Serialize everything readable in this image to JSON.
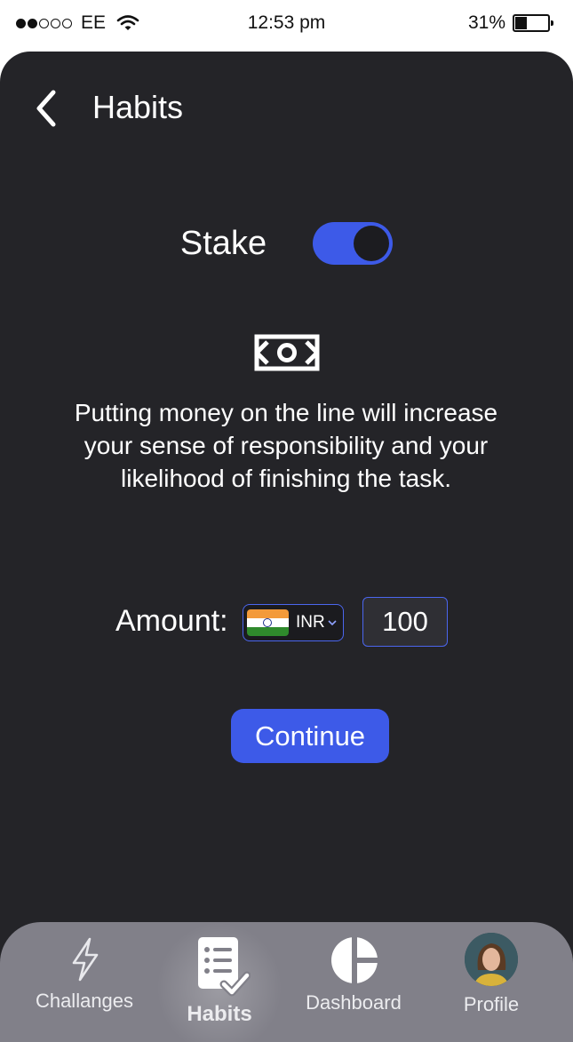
{
  "status_bar": {
    "carrier": "EE",
    "time": "12:53 pm",
    "battery": "31%",
    "battery_level": 0.31,
    "signal_bars_filled": 2,
    "signal_bars_total": 5
  },
  "header": {
    "title": "Habits",
    "back_icon": "chevron-left-icon"
  },
  "stake": {
    "label": "Stake",
    "enabled": true,
    "toggle_color": "#3d5ae8"
  },
  "info": {
    "icon": "money-icon",
    "text": "Putting money on the line will increase your sense of responsibility and your likelihood of finishing the task."
  },
  "amount": {
    "label": "Amount:",
    "currency": "INR",
    "currency_flag": "india-flag-icon",
    "value": "100"
  },
  "continue_label": "Continue",
  "tabs": [
    {
      "label": "Challanges",
      "icon": "lightning-icon",
      "active": false
    },
    {
      "label": "Habits",
      "icon": "checklist-icon",
      "active": true
    },
    {
      "label": "Dashboard",
      "icon": "pie-chart-icon",
      "active": false
    },
    {
      "label": "Profile",
      "icon": "avatar",
      "active": false
    }
  ],
  "colors": {
    "background": "#242428",
    "accent": "#3d5ae8",
    "tab_bar": "#818089"
  }
}
